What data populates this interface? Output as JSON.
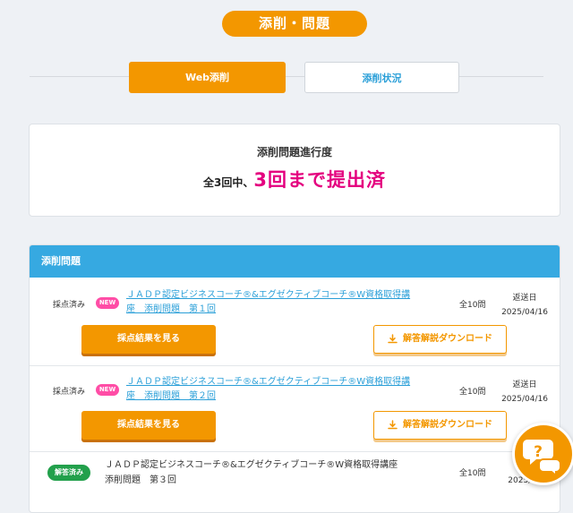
{
  "page_title": "添削・問題",
  "tabs": [
    {
      "label": "Web添削",
      "active": true
    },
    {
      "label": "添削状況",
      "active": false
    }
  ],
  "progress": {
    "title": "添削問題進行度",
    "prefix": "全3回中、",
    "highlight": "3回まで提出済"
  },
  "list": {
    "header": "添削問題",
    "rows": [
      {
        "status": "採点済み",
        "new_badge": "NEW",
        "title_line1": "ＪＡＤＰ認定ビジネスコーチ®&エグゼクティブコーチ®W資格取得講",
        "title_line2": "座　添削問題　第１回",
        "count": "全10問",
        "sent_label": "返送日",
        "sent_date": "2025/04/16",
        "result_button": "採点結果を見る",
        "download_button": "解答解説ダウンロード"
      },
      {
        "status": "採点済み",
        "new_badge": "NEW",
        "title_line1": "ＪＡＤＰ認定ビジネスコーチ®&エグゼクティブコーチ®W資格取得講",
        "title_line2": "座　添削問題　第２回",
        "count": "全10問",
        "sent_label": "返送日",
        "sent_date": "2025/04/16",
        "result_button": "採点結果を見る",
        "download_button": "解答解説ダウンロード"
      },
      {
        "status": "解答済み",
        "title_line1": "ＪＡＤＰ認定ビジネスコーチ®&エグゼクティブコーチ®W資格取得講座",
        "title_line2": "添削問題　第３回",
        "count": "全10問",
        "sent_label": "提",
        "sent_date": "2025/04"
      }
    ]
  },
  "help_icon": "question-chat-icon",
  "colors": {
    "accent_orange": "#f39700",
    "header_blue": "#36a9e1",
    "highlight_pink": "#e4007f",
    "new_badge": "#ff4da6",
    "answered_green": "#22a04b",
    "link_blue": "#2a9fd8"
  }
}
